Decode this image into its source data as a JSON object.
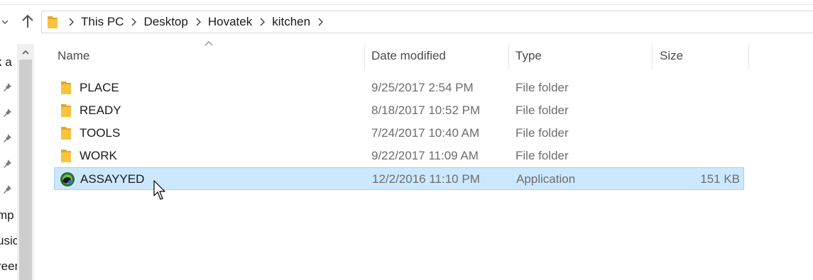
{
  "breadcrumb": [
    "This PC",
    "Desktop",
    "Hovatek",
    "kitchen"
  ],
  "nav_pane": {
    "quick_access_partial": "k a",
    "items_partial": [
      "mp",
      "usic",
      "reer"
    ]
  },
  "columns": {
    "name": "Name",
    "date_modified": "Date modified",
    "type": "Type",
    "size": "Size"
  },
  "files": [
    {
      "name": "PLACE",
      "date": "9/25/2017 2:54 PM",
      "type": "File folder",
      "size": "",
      "kind": "folder"
    },
    {
      "name": "READY",
      "date": "8/18/2017 10:52 PM",
      "type": "File folder",
      "size": "",
      "kind": "folder"
    },
    {
      "name": "TOOLS",
      "date": "7/24/2017 10:40 AM",
      "type": "File folder",
      "size": "",
      "kind": "folder"
    },
    {
      "name": "WORK",
      "date": "9/22/2017 11:09 AM",
      "type": "File folder",
      "size": "",
      "kind": "folder"
    },
    {
      "name": "ASSAYYED",
      "date": "12/2/2016 11:10 PM",
      "type": "Application",
      "size": "151 KB",
      "kind": "application",
      "selected": true
    }
  ],
  "colors": {
    "selection_bg": "#cce8ff",
    "selection_border": "#99d1ff",
    "folder_yellow": "#f8c33d"
  },
  "icons": {
    "folder": "folder-icon",
    "application": "app-icon",
    "up": "up-arrow-icon",
    "pin": "pin-icon"
  }
}
